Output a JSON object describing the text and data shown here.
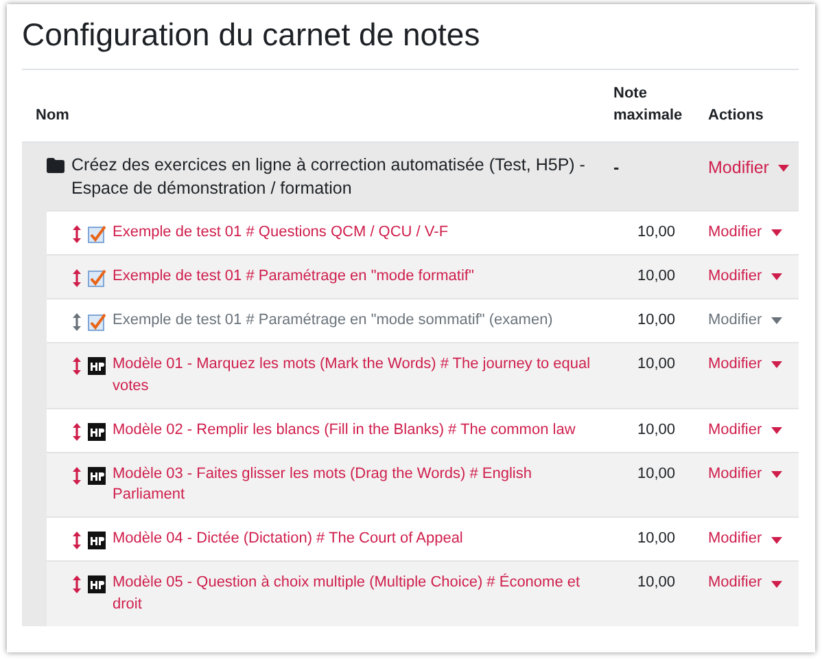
{
  "title": "Configuration du carnet de notes",
  "columns": [
    "Nom",
    "Note maximale",
    "Actions"
  ],
  "category": {
    "name": "Créez des exercices en ligne à correction automatisée (Test, H5P) - Espace de démonstration / formation",
    "max_grade": "-",
    "action": "Modifier"
  },
  "items": [
    {
      "kind": "quiz",
      "name": "Exemple de test 01 # Questions QCM / QCU / V-F",
      "max_grade": "10,00",
      "action": "Modifier",
      "hidden": false
    },
    {
      "kind": "quiz",
      "name": "Exemple de test 01 # Paramétrage en \"mode formatif\"",
      "max_grade": "10,00",
      "action": "Modifier",
      "hidden": false
    },
    {
      "kind": "quiz",
      "name": "Exemple de test 01 # Paramétrage en \"mode sommatif\" (examen)",
      "max_grade": "10,00",
      "action": "Modifier",
      "hidden": true
    },
    {
      "kind": "h5p",
      "name": "Modèle 01 - Marquez les mots (Mark the Words) # The journey to equal votes",
      "max_grade": "10,00",
      "action": "Modifier",
      "hidden": false
    },
    {
      "kind": "h5p",
      "name": "Modèle 02 - Remplir les blancs (Fill in the Blanks) # The common law",
      "max_grade": "10,00",
      "action": "Modifier",
      "hidden": false
    },
    {
      "kind": "h5p",
      "name": "Modèle 03 - Faites glisser les mots (Drag the Words) # English Parliament",
      "max_grade": "10,00",
      "action": "Modifier",
      "hidden": false
    },
    {
      "kind": "h5p",
      "name": "Modèle 04 - Dictée (Dictation) # The Court of Appeal",
      "max_grade": "10,00",
      "action": "Modifier",
      "hidden": false
    },
    {
      "kind": "h5p",
      "name": "Modèle 05 - Question à choix multiple (Multiple Choice) # Économe et droit",
      "max_grade": "10,00",
      "action": "Modifier",
      "hidden": false
    }
  ]
}
